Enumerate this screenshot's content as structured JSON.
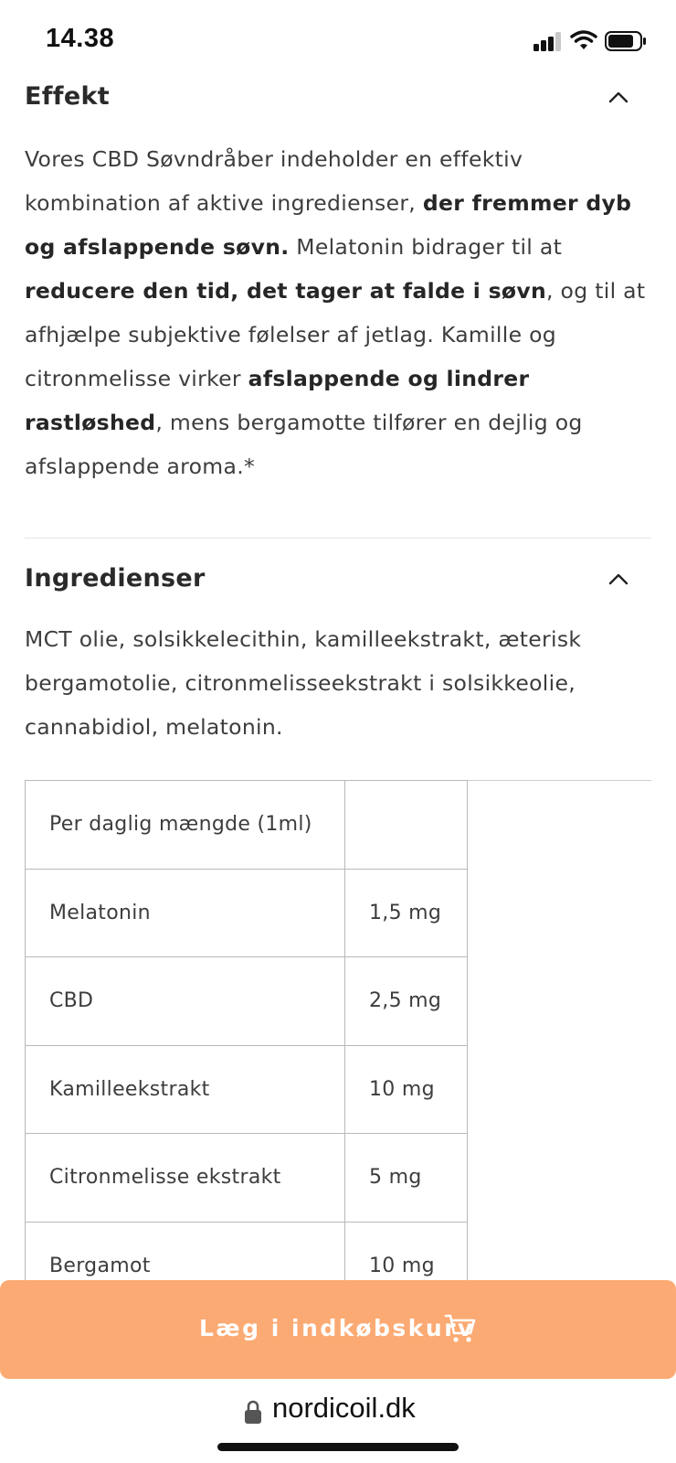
{
  "status_bar": {
    "time": "14.38"
  },
  "effekt": {
    "title": "Effekt",
    "segments": [
      {
        "text": "Vores CBD Søvndråber indeholder en effektiv kombination af aktive ingredienser, ",
        "bold": false
      },
      {
        "text": "der fremmer dyb og afslappende søvn.",
        "bold": true
      },
      {
        "text": " Melatonin bidrager til at ",
        "bold": false
      },
      {
        "text": "reducere den tid, det tager at falde i søvn",
        "bold": true
      },
      {
        "text": ", og til at afhjælpe subjektive følelser af jetlag. Kamille og citronmelisse virker ",
        "bold": false
      },
      {
        "text": "afslappende og lindrer rastløshed",
        "bold": true
      },
      {
        "text": ", mens bergamotte tilfører en dejlig og afslappende aroma.*",
        "bold": false
      }
    ]
  },
  "ingredienser": {
    "title": "Ingredienser",
    "text": "MCT olie, solsikkelecithin, kamilleekstrakt, æterisk bergamotolie, citronmelisseekstrakt i solsikkeolie, cannabidiol, melatonin."
  },
  "nutrition_table": {
    "header": "Per daglig mængde (1ml)",
    "rows": [
      {
        "name": "Melatonin",
        "amount": "1,5 mg"
      },
      {
        "name": "CBD",
        "amount": "2,5 mg"
      },
      {
        "name": "Kamilleekstrakt",
        "amount": "10 mg"
      },
      {
        "name": "Citronmelisse ekstrakt",
        "amount": "5 mg"
      },
      {
        "name": "Bergamot",
        "amount": "10 mg"
      }
    ]
  },
  "cart_button": {
    "label": "Læg i indkøbskurv",
    "icon": "cart-icon",
    "color": "#fbaa73"
  },
  "url_bar": {
    "domain": "nordicoil.dk",
    "icon": "lock-icon"
  }
}
